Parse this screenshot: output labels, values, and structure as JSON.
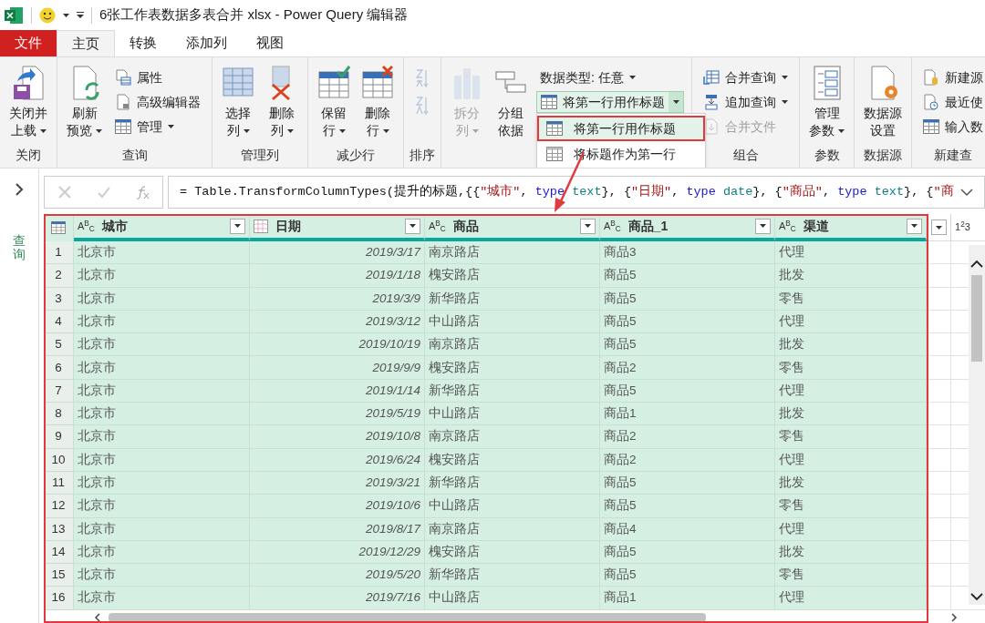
{
  "window": {
    "title": "6张工作表数据多表合并 xlsx - Power Query 编辑器"
  },
  "tabs": [
    {
      "label": "文件",
      "kind": "file",
      "selected": false
    },
    {
      "label": "主页",
      "kind": "tab",
      "selected": true
    },
    {
      "label": "转换",
      "kind": "tab",
      "selected": false
    },
    {
      "label": "添加列",
      "kind": "tab",
      "selected": false
    },
    {
      "label": "视图",
      "kind": "tab",
      "selected": false
    }
  ],
  "ribbon": [
    {
      "label": "关闭",
      "items": [
        {
          "kind": "large",
          "lines": [
            "关闭并",
            "上载"
          ],
          "dropdown": true,
          "disabled": false
        }
      ]
    },
    {
      "label": "查询",
      "items": [
        {
          "kind": "large",
          "lines": [
            "刷新",
            "预览"
          ],
          "dropdown": true,
          "disabled": false
        },
        {
          "kind": "stack",
          "entries": [
            {
              "label": "属性",
              "dropdown": false,
              "disabled": false
            },
            {
              "label": "高级编辑器",
              "dropdown": false,
              "disabled": false
            },
            {
              "label": "管理",
              "dropdown": true,
              "disabled": false
            }
          ]
        }
      ]
    },
    {
      "label": "管理列",
      "items": [
        {
          "kind": "large",
          "lines": [
            "选择",
            "列"
          ],
          "dropdown": true,
          "disabled": false
        },
        {
          "kind": "large",
          "lines": [
            "删除",
            "列"
          ],
          "dropdown": true,
          "disabled": false
        }
      ]
    },
    {
      "label": "减少行",
      "items": [
        {
          "kind": "large",
          "lines": [
            "保留",
            "行"
          ],
          "dropdown": true,
          "disabled": false
        },
        {
          "kind": "large",
          "lines": [
            "删除",
            "行"
          ],
          "dropdown": true,
          "disabled": false
        }
      ]
    },
    {
      "label": "排序",
      "items": [
        {
          "kind": "sort",
          "disabled": true
        }
      ]
    },
    {
      "items": [
        {
          "kind": "large",
          "lines": [
            "拆分",
            "列"
          ],
          "dropdown": true,
          "disabled": true
        },
        {
          "kind": "large",
          "lines": [
            "分组",
            "依据"
          ],
          "dropdown": false,
          "disabled": false
        },
        {
          "kind": "stack",
          "entries": [
            {
              "label": "数据类型: 任意",
              "dropdown": true,
              "disabled": false
            },
            {
              "label": "将第一行用作标题",
              "dropdown": true,
              "disabled": false,
              "split": true,
              "expanded": true,
              "menu": [
                {
                  "label": "将第一行用作标题",
                  "selected": true
                },
                {
                  "label": "将标题作为第一行",
                  "selected": false
                }
              ]
            }
          ]
        }
      ]
    },
    {
      "label": "组合",
      "items": [
        {
          "kind": "stack",
          "entries": [
            {
              "label": "合并查询",
              "dropdown": true,
              "disabled": false
            },
            {
              "label": "追加查询",
              "dropdown": true,
              "disabled": false
            },
            {
              "label": "合并文件",
              "dropdown": false,
              "disabled": true
            }
          ]
        }
      ]
    },
    {
      "label": "参数",
      "items": [
        {
          "kind": "large",
          "lines": [
            "管理",
            "参数"
          ],
          "dropdown": true,
          "disabled": false
        }
      ]
    },
    {
      "label": "数据源",
      "items": [
        {
          "kind": "large",
          "lines": [
            "数据源",
            "设置"
          ],
          "dropdown": false,
          "disabled": false
        }
      ]
    },
    {
      "label": "新建查",
      "items": [
        {
          "kind": "stack",
          "entries": [
            {
              "label": "新建源",
              "dropdown": false,
              "disabled": false
            },
            {
              "label": "最近使",
              "dropdown": false,
              "disabled": false
            },
            {
              "label": "输入数",
              "dropdown": false,
              "disabled": false
            }
          ]
        }
      ]
    }
  ],
  "sidebar": {
    "label": "查询",
    "expanded": false
  },
  "formula": [
    {
      "kind": "plain",
      "text": "= Table.TransformColumnTypes(提升的标题,{{"
    },
    {
      "kind": "string",
      "text": "\"城市\""
    },
    {
      "kind": "plain",
      "text": ", "
    },
    {
      "kind": "keyword",
      "text": "type"
    },
    {
      "kind": "type",
      "text": " text"
    },
    {
      "kind": "plain",
      "text": "}, {"
    },
    {
      "kind": "string",
      "text": "\"日期\""
    },
    {
      "kind": "plain",
      "text": ", "
    },
    {
      "kind": "keyword",
      "text": "type"
    },
    {
      "kind": "type",
      "text": " date"
    },
    {
      "kind": "plain",
      "text": "}, {"
    },
    {
      "kind": "string",
      "text": "\"商品\""
    },
    {
      "kind": "plain",
      "text": ", "
    },
    {
      "kind": "keyword",
      "text": "type"
    },
    {
      "kind": "type",
      "text": " text"
    },
    {
      "kind": "plain",
      "text": "}, {"
    },
    {
      "kind": "string",
      "text": "\"商"
    }
  ],
  "table": {
    "columns": [
      {
        "kind": "text",
        "type_label": "A$^{B}$$_{C}$",
        "label": "城市",
        "selected": true
      },
      {
        "kind": "date",
        "label": "日期",
        "selected": true
      },
      {
        "kind": "text",
        "type_label": "A$^{B}$$_{C}$",
        "label": "商品",
        "selected": true
      },
      {
        "kind": "text",
        "type_label": "A$^{B}$$_{C}$",
        "label": "商品_1",
        "selected": true
      },
      {
        "kind": "text",
        "type_label": "A$^{B}$$_{C}$",
        "label": "渠道",
        "selected": true
      },
      {
        "kind": "blank",
        "selected": false
      },
      {
        "kind": "number",
        "type_label": "1$^{2}$3",
        "selected": false
      }
    ],
    "rows": [
      {
        "number": "1",
        "cells": [
          "北京市",
          "2019/3/17",
          "南京路店",
          "商品3",
          "代理"
        ]
      },
      {
        "number": "2",
        "cells": [
          "北京市",
          "2019/1/18",
          "槐安路店",
          "商品5",
          "批发"
        ]
      },
      {
        "number": "3",
        "cells": [
          "北京市",
          "2019/3/9",
          "新华路店",
          "商品5",
          "零售"
        ]
      },
      {
        "number": "4",
        "cells": [
          "北京市",
          "2019/3/12",
          "中山路店",
          "商品5",
          "代理"
        ]
      },
      {
        "number": "5",
        "cells": [
          "北京市",
          "2019/10/19",
          "南京路店",
          "商品5",
          "批发"
        ]
      },
      {
        "number": "6",
        "cells": [
          "北京市",
          "2019/9/9",
          "槐安路店",
          "商品2",
          "零售"
        ]
      },
      {
        "number": "7",
        "cells": [
          "北京市",
          "2019/1/14",
          "新华路店",
          "商品5",
          "代理"
        ]
      },
      {
        "number": "8",
        "cells": [
          "北京市",
          "2019/5/19",
          "中山路店",
          "商品1",
          "批发"
        ]
      },
      {
        "number": "9",
        "cells": [
          "北京市",
          "2019/10/8",
          "南京路店",
          "商品2",
          "零售"
        ]
      },
      {
        "number": "10",
        "cells": [
          "北京市",
          "2019/6/24",
          "槐安路店",
          "商品2",
          "代理"
        ]
      },
      {
        "number": "11",
        "cells": [
          "北京市",
          "2019/3/21",
          "新华路店",
          "商品5",
          "批发"
        ]
      },
      {
        "number": "12",
        "cells": [
          "北京市",
          "2019/10/6",
          "中山路店",
          "商品5",
          "零售"
        ]
      },
      {
        "number": "13",
        "cells": [
          "北京市",
          "2019/8/17",
          "南京路店",
          "商品4",
          "代理"
        ]
      },
      {
        "number": "14",
        "cells": [
          "北京市",
          "2019/12/29",
          "槐安路店",
          "商品5",
          "批发"
        ]
      },
      {
        "number": "15",
        "cells": [
          "北京市",
          "2019/5/20",
          "新华路店",
          "商品5",
          "零售"
        ]
      },
      {
        "number": "16",
        "cells": [
          "北京市",
          "2019/7/16",
          "中山路店",
          "商品1",
          "代理"
        ]
      }
    ]
  }
}
